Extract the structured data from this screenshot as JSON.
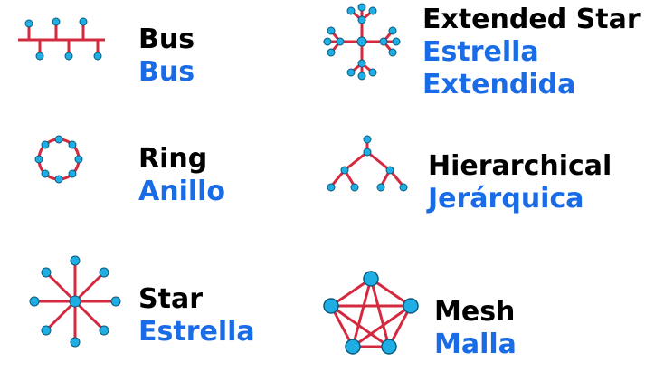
{
  "colors": {
    "link": "#d32a3f",
    "node_fill": "#1eaee4",
    "node_stroke": "#0b5a7c",
    "english_text": "#000000",
    "spanish_text": "#1a6be6"
  },
  "topologies": [
    {
      "id": "bus",
      "icon": "bus-topology-icon",
      "english": "Bus",
      "spanish": "Bus"
    },
    {
      "id": "ring",
      "icon": "ring-topology-icon",
      "english": "Ring",
      "spanish": "Anillo"
    },
    {
      "id": "star",
      "icon": "star-topology-icon",
      "english": "Star",
      "spanish": "Estrella"
    },
    {
      "id": "extended-star",
      "icon": "extended-star-topology-icon",
      "english": "Extended Star",
      "spanish_line1": "Estrella",
      "spanish_line2": "Extendida"
    },
    {
      "id": "hierarchical",
      "icon": "hierarchical-topology-icon",
      "english": "Hierarchical",
      "spanish": "Jerárquica"
    },
    {
      "id": "mesh",
      "icon": "mesh-topology-icon",
      "english": "Mesh",
      "spanish": "Malla"
    }
  ]
}
